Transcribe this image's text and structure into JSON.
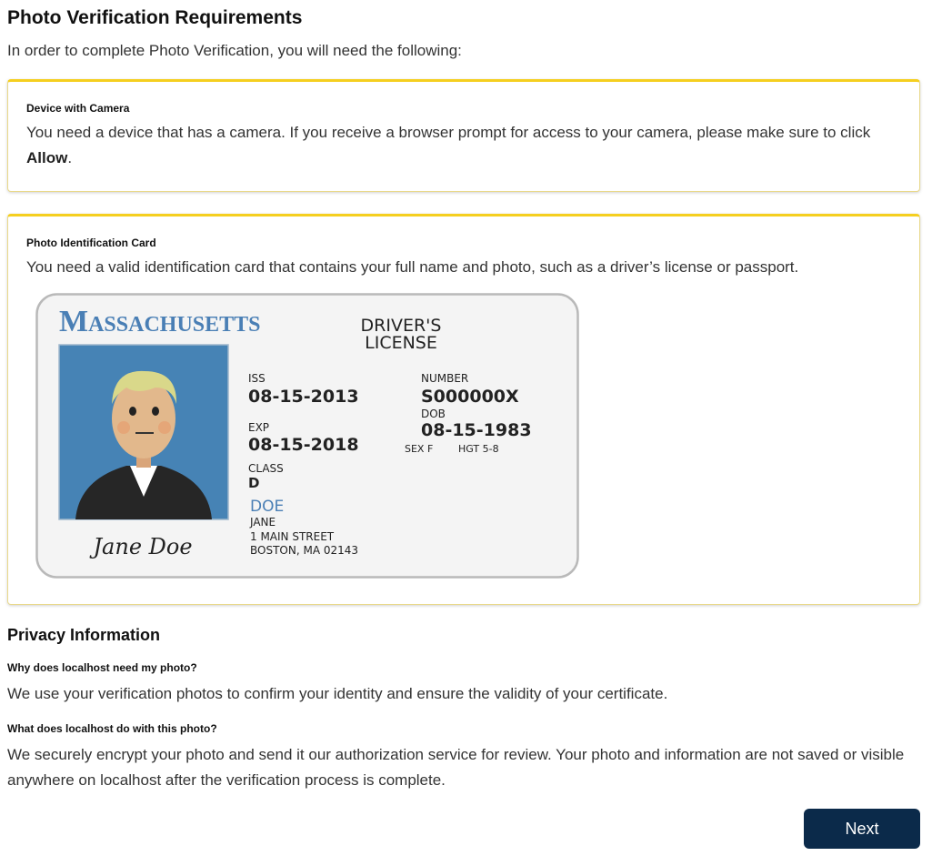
{
  "page": {
    "title": "Photo Verification Requirements",
    "intro": "In order to complete Photo Verification, you will need the following:"
  },
  "camera_card": {
    "title": "Device with Camera",
    "text_before": "You need a device that has a camera. If you receive a browser prompt for access to your camera, please make sure to click ",
    "text_bold": "Allow",
    "text_after": "."
  },
  "id_card_section": {
    "title": "Photo Identification Card",
    "text": "You need a valid identification card that contains your full name and photo, such as a driver’s license or passport."
  },
  "sample_license": {
    "state_initial": "M",
    "state_rest": "ASSACHUSETTS",
    "doc_line1": "DRIVER'S",
    "doc_line2": "LICENSE",
    "iss_label": "ISS",
    "iss_value": "08-15-2013",
    "exp_label": "EXP",
    "exp_value": "08-15-2018",
    "class_label": "CLASS",
    "class_value": "D",
    "number_label": "NUMBER",
    "number_value": "S000000X",
    "dob_label": "DOB",
    "dob_value": "08-15-1983",
    "sex": "SEX F",
    "height": "HGT 5-8",
    "last_name": "DOE",
    "first_name": "JANE",
    "address1": "1 MAIN STREET",
    "address2": "BOSTON, MA 02143",
    "signature": "Jane Doe",
    "colors": {
      "state_blue": "#4a7fb5",
      "photo_bg": "#4683b5",
      "card_bg": "#f4f4f4"
    }
  },
  "privacy": {
    "title": "Privacy Information",
    "q1": "Why does localhost need my photo?",
    "a1": "We use your verification photos to confirm your identity and ensure the validity of your certificate.",
    "q2": "What does localhost do with this photo?",
    "a2": "We securely encrypt your photo and send it our authorization service for review. Your photo and information are not saved or visible anywhere on localhost after the verification process is complete."
  },
  "actions": {
    "next_label": "Next"
  },
  "colors": {
    "accent_yellow": "#f5cf1f",
    "button_navy": "#0b2a4a"
  }
}
